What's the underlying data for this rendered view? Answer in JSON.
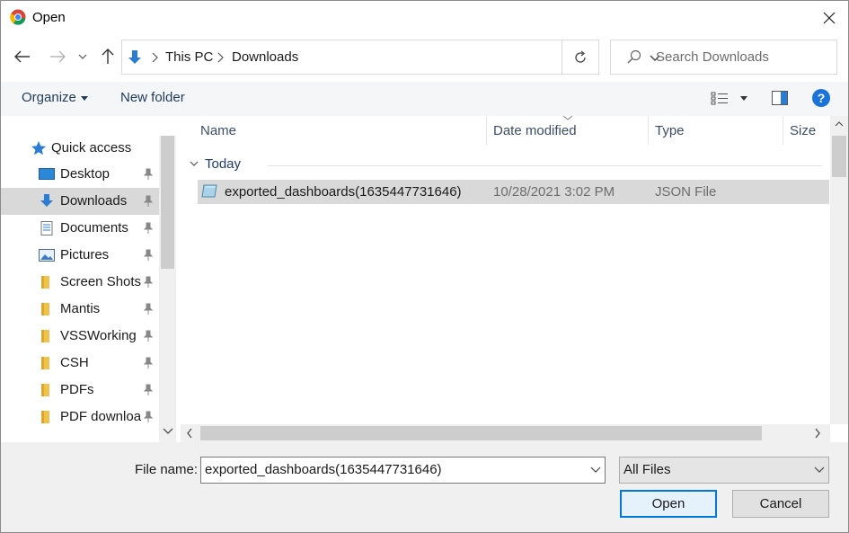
{
  "window": {
    "title": "Open"
  },
  "address": {
    "crumbs": [
      "This PC",
      "Downloads"
    ]
  },
  "search": {
    "placeholder": "Search Downloads"
  },
  "toolbar": {
    "organize": "Organize",
    "new_folder": "New folder",
    "help": "?"
  },
  "nav": {
    "quick_access": "Quick access",
    "items": [
      {
        "label": "Desktop",
        "icon": "desktop-icon"
      },
      {
        "label": "Downloads",
        "icon": "downloads-icon",
        "selected": true
      },
      {
        "label": "Documents",
        "icon": "documents-icon"
      },
      {
        "label": "Pictures",
        "icon": "pictures-icon"
      },
      {
        "label": "Screen Shots",
        "icon": "folder-icon"
      },
      {
        "label": "Mantis",
        "icon": "folder-icon"
      },
      {
        "label": "VSSWorking",
        "icon": "folder-icon"
      },
      {
        "label": "CSH",
        "icon": "folder-icon"
      },
      {
        "label": "PDFs",
        "icon": "folder-icon"
      },
      {
        "label": "PDF downloa",
        "icon": "folder-icon"
      }
    ]
  },
  "columns": {
    "name": "Name",
    "date": "Date modified",
    "type": "Type",
    "size": "Size"
  },
  "group": {
    "label": "Today"
  },
  "files": [
    {
      "name": "exported_dashboards(1635447731646)",
      "date": "10/28/2021 3:02 PM",
      "type": "JSON File"
    }
  ],
  "bottom": {
    "file_name_label": "File name:",
    "file_name_value": "exported_dashboards(1635447731646)",
    "filter": "All Files",
    "open": "Open",
    "cancel": "Cancel"
  },
  "colors": {
    "accent": "#0078d7",
    "selection": "#d9d9d9",
    "toolbar_bg": "#f5f6f7",
    "footer_bg": "#f0f0f0"
  }
}
